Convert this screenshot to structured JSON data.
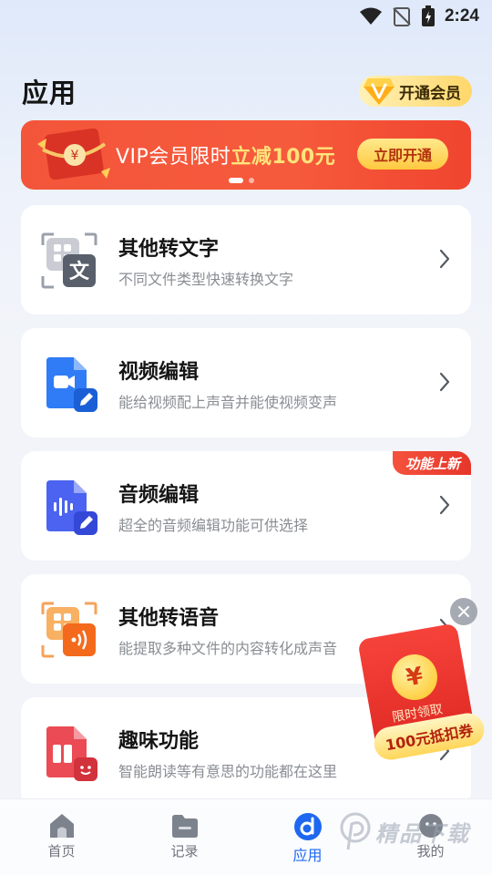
{
  "status_bar": {
    "time": "2:24",
    "icons": [
      "wifi-icon",
      "no-sim-icon",
      "battery-charging-icon"
    ]
  },
  "header": {
    "title": "应用",
    "vip_button": {
      "label": "开通会员",
      "icon": "vip-diamond-icon"
    }
  },
  "banner": {
    "text_prefix": "VIP会员限时",
    "text_highlight": "立减100元",
    "button_label": "立即开通",
    "page_indicator": {
      "current": 1,
      "total": 2
    }
  },
  "features": [
    {
      "title": "其他转文字",
      "subtitle": "不同文件类型快速转换文字",
      "icon": "file-to-text-icon",
      "badge": ""
    },
    {
      "title": "视频编辑",
      "subtitle": "能给视频配上声音并能使视频变声",
      "icon": "video-edit-icon",
      "badge": ""
    },
    {
      "title": "音频编辑",
      "subtitle": "超全的音频编辑功能可供选择",
      "icon": "audio-edit-icon",
      "badge": "功能上新"
    },
    {
      "title": "其他转语音",
      "subtitle": "能提取多种文件的内容转化成声音",
      "icon": "file-to-speech-icon",
      "badge": ""
    },
    {
      "title": "趣味功能",
      "subtitle": "智能朗读等有意思的功能都在这里",
      "icon": "fun-feature-icon",
      "badge": ""
    }
  ],
  "floating_promo": {
    "coin_symbol": "¥",
    "text": "限时领取",
    "tag": "100元抵扣券"
  },
  "bottom_nav": [
    {
      "label": "首页",
      "icon": "home-icon",
      "active": false
    },
    {
      "label": "记录",
      "icon": "folder-icon",
      "active": false
    },
    {
      "label": "应用",
      "icon": "apps-icon",
      "active": true
    },
    {
      "label": "我的",
      "icon": "profile-icon",
      "active": false
    }
  ],
  "watermark": {
    "text": "精品下载"
  },
  "colors": {
    "accent": "#1e67f0",
    "banner_red": "#f3553a",
    "vip_gold": "#ffd76a",
    "badge_red": "#e6362a"
  }
}
